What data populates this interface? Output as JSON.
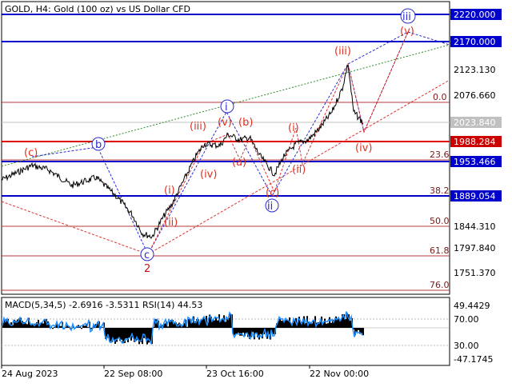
{
  "header": {
    "title": "GOLD, H4:  Gold (100 oz) vs US Dollar CFD"
  },
  "price_axis": {
    "labels": [
      "2123.130",
      "2076.660",
      "1844.310",
      "1797.840",
      "1751.370"
    ]
  },
  "price_boxes": {
    "level_2220": {
      "label": "2220.000",
      "bg": "#0000cc",
      "fg": "#ffffff"
    },
    "level_2170": {
      "label": "2170.000",
      "bg": "#0000cc",
      "fg": "#ffffff"
    },
    "current": {
      "label": "2023.840",
      "bg": "#c0c0c0",
      "fg": "#ffffff"
    },
    "level_1988": {
      "label": "1988.284",
      "bg": "#cc0000",
      "fg": "#ffffff"
    },
    "level_1953": {
      "label": "1953.466",
      "bg": "#0000cc",
      "fg": "#ffffff"
    },
    "level_1889": {
      "label": "1889.054",
      "bg": "#0000cc",
      "fg": "#ffffff"
    }
  },
  "fib_levels": [
    "0.0",
    "23.6",
    "38.2",
    "50.0",
    "61.8",
    "76.0"
  ],
  "wave_labels": {
    "c_small": "(c)",
    "b_circle": "b",
    "c_circle": "c",
    "two": "2",
    "i_bracket": "(i)",
    "ii_bracket": "(ii)",
    "iii_bracket": "(iii)",
    "iv_bracket": "(iv)",
    "v_bracket": "(v)",
    "b_bracket": "(b)",
    "a_bracket": "(a)",
    "c_bracket": "(c)",
    "i_circle": "i",
    "ii_circle": "ii",
    "iii_circle": "iii",
    "i2_bracket": "(i)",
    "ii2_bracket": "(ii)",
    "iii2_bracket": "(iii)",
    "iv2_bracket": "(iv)",
    "v2_bracket": "(v)"
  },
  "indicator": {
    "title": "MACD(5,34,5) -2.6916 -3.5311 RSI(14) 44.53",
    "axis": [
      "49.4429",
      "70.00",
      "30.00",
      "-47.1745"
    ]
  },
  "time_axis": [
    "24 Aug 2023",
    "22 Sep 08:00",
    "23 Oct 16:00",
    "22 Nov 00:00"
  ]
}
